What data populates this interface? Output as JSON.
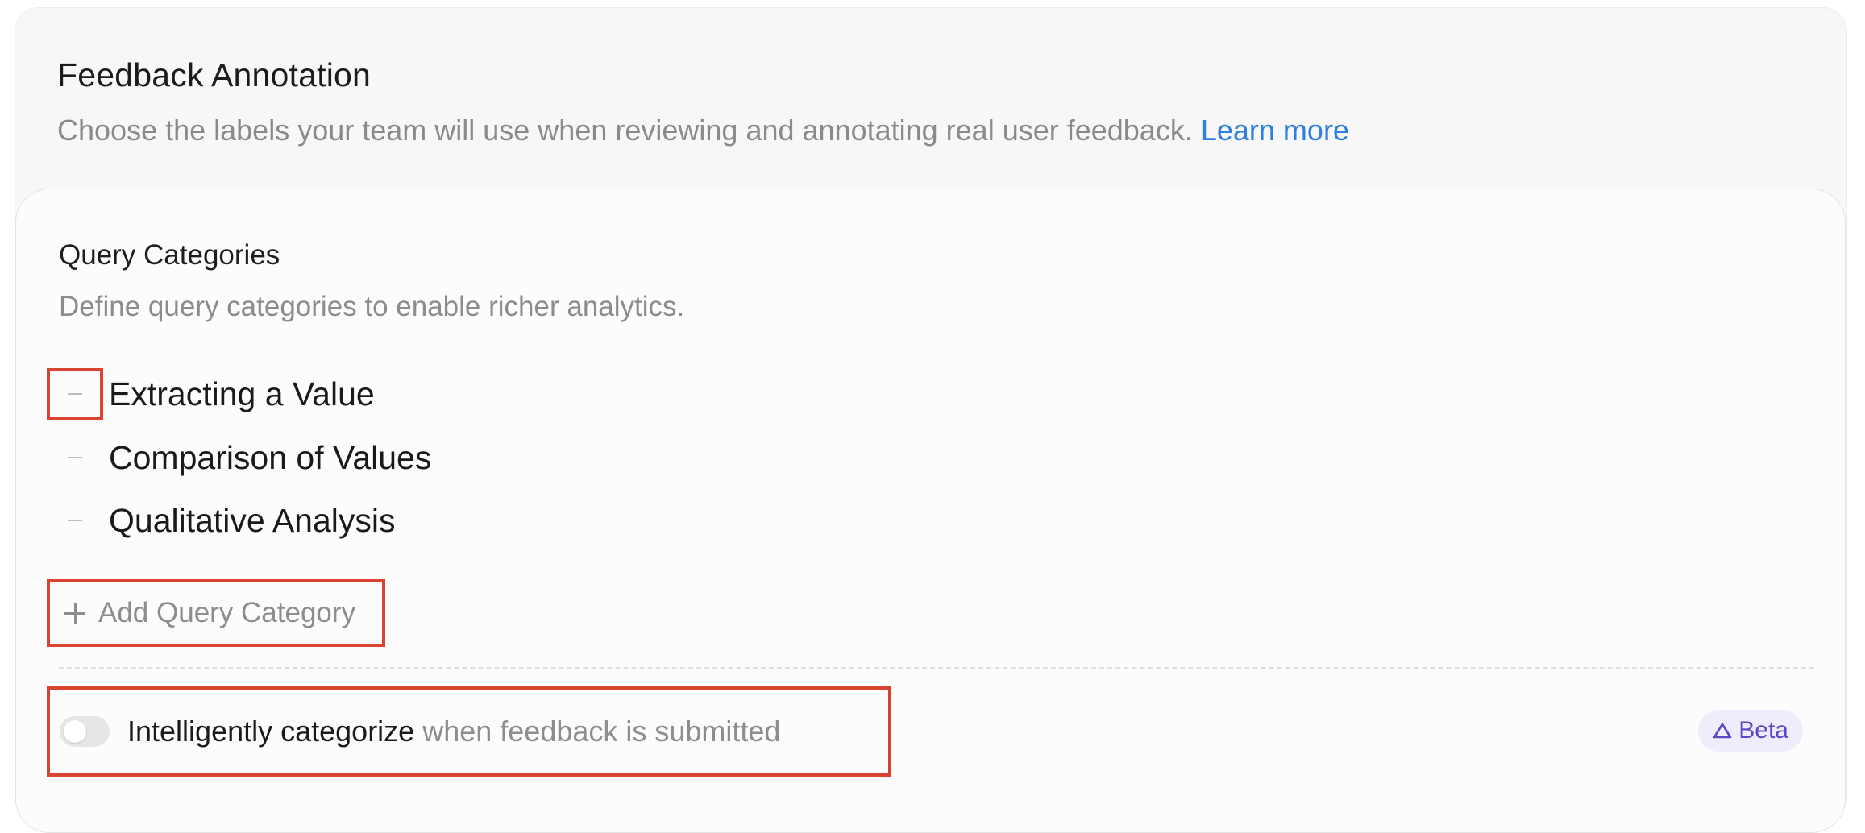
{
  "header": {
    "title": "Feedback Annotation",
    "description": "Choose the labels your team will use when reviewing and annotating real user feedback.",
    "learn_more": "Learn more"
  },
  "query_categories": {
    "title": "Query Categories",
    "description": "Define query categories to enable richer analytics.",
    "items": [
      {
        "label": "Extracting a Value",
        "remove_icon": "minus-icon"
      },
      {
        "label": "Comparison of Values",
        "remove_icon": "minus-icon"
      },
      {
        "label": "Qualitative Analysis",
        "remove_icon": "minus-icon"
      }
    ],
    "add_button": "Add Query Category",
    "add_icon": "plus-icon"
  },
  "auto_categorize": {
    "label_strong": "Intelligently categorize",
    "label_rest": "when feedback is submitted",
    "enabled": false,
    "badge": "Beta",
    "badge_icon": "triangle-icon"
  },
  "colors": {
    "link": "#2f7ee0",
    "highlight": "#d94432",
    "badge_text": "#5a48c8",
    "badge_bg": "#efecfb"
  }
}
